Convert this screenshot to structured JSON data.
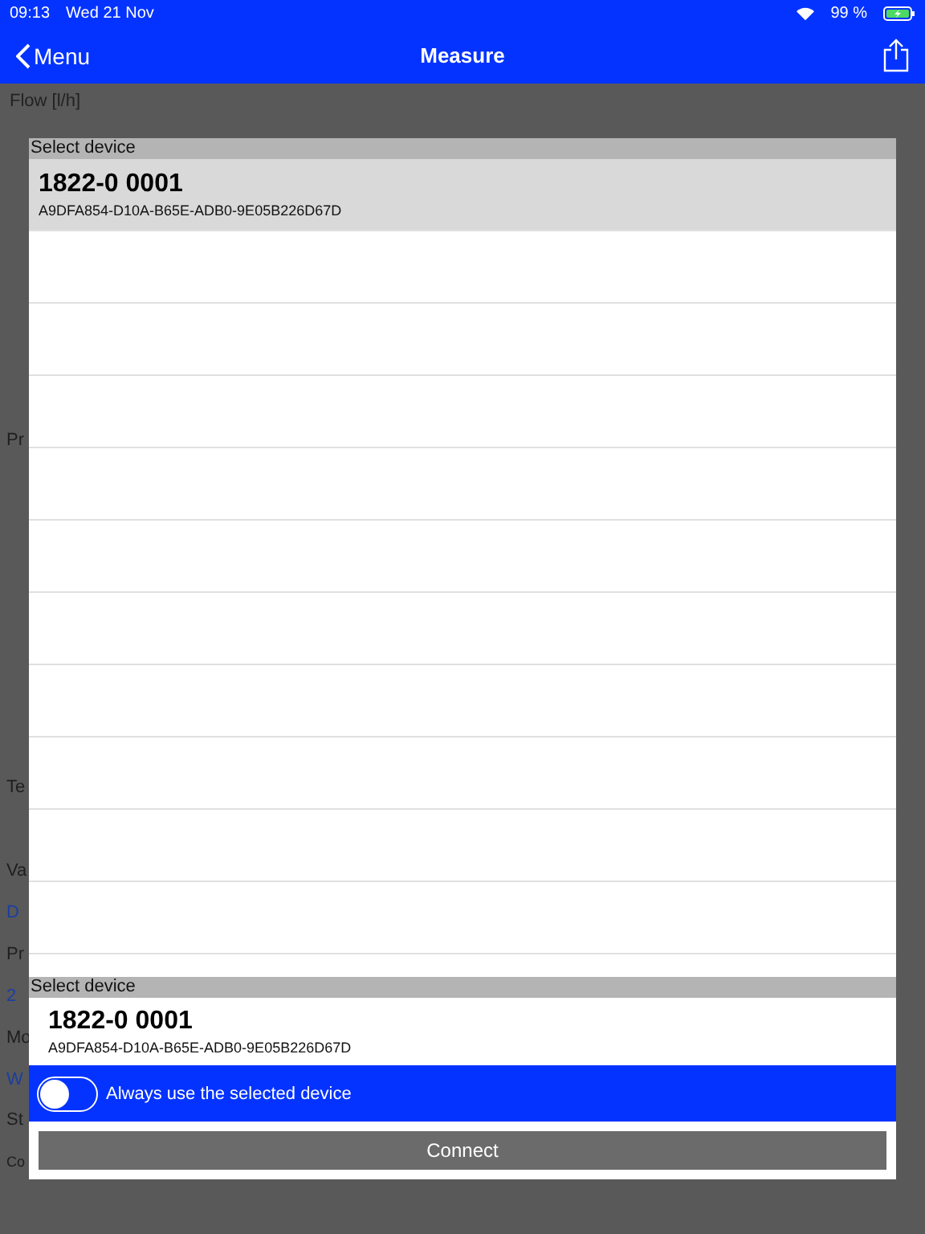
{
  "status_bar": {
    "time": "09:13",
    "date": "Wed 21 Nov",
    "battery": "99 %"
  },
  "nav": {
    "back": "Menu",
    "title": "Measure"
  },
  "page": {
    "heading": "Flow [l/h]",
    "fragments": [
      {
        "text": "Pr",
        "kind": "label"
      },
      {
        "text": "Te",
        "kind": "label"
      },
      {
        "text": "Va",
        "kind": "label"
      },
      {
        "text": "D",
        "kind": "value"
      },
      {
        "text": "Pr",
        "kind": "label"
      },
      {
        "text": "2",
        "kind": "value"
      },
      {
        "text": "Mo",
        "kind": "label"
      },
      {
        "text": "W",
        "kind": "value"
      },
      {
        "text": "St",
        "kind": "label"
      },
      {
        "text": "Co",
        "kind": "small"
      }
    ]
  },
  "dialog": {
    "list_header": "Select device",
    "devices": [
      {
        "name": "1822-0 0001",
        "id": "A9DFA854-D10A-B65E-ADB0-9E05B226D67D",
        "selected": true
      }
    ],
    "selected_header": "Select device",
    "selected_device": {
      "name": "1822-0 0001",
      "id": "A9DFA854-D10A-B65E-ADB0-9E05B226D67D"
    },
    "always_use": {
      "label": "Always use the selected device",
      "on": false
    },
    "connect": "Connect"
  }
}
